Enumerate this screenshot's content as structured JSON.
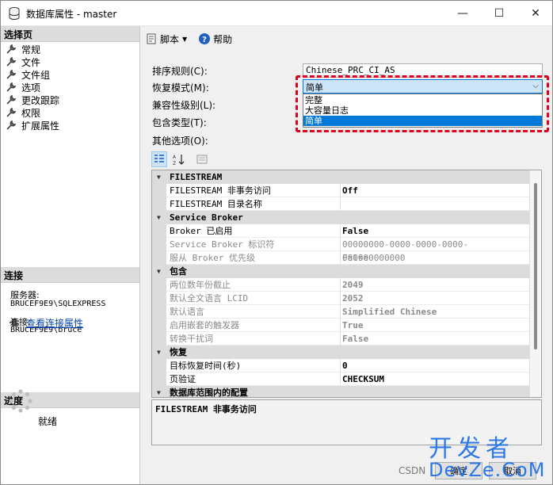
{
  "window": {
    "title": "数据库属性 - master",
    "minimize": "—",
    "maximize": "☐",
    "close": "✕"
  },
  "left_pane": {
    "select_page_header": "选择页",
    "nav_items": [
      "常规",
      "文件",
      "文件组",
      "选项",
      "更改跟踪",
      "权限",
      "扩展属性"
    ],
    "connection_header": "连接",
    "server_label": "服务器:",
    "server_value": "BRUCEF9E9\\SQLEXPRESS",
    "connection_label": "连接:",
    "connection_value": "BRUCEF9E9\\bruce",
    "view_conn_props": "查看连接属性",
    "progress_header": "进度",
    "progress_status": "就绪"
  },
  "toolbar": {
    "script_label": "脚本",
    "help_label": "帮助"
  },
  "form": {
    "collation_label": "排序规则(C):",
    "collation_value": "Chinese_PRC_CI_AS",
    "recovery_label": "恢复模式(M):",
    "recovery_value": "简单",
    "compat_label": "兼容性级别(L):",
    "containment_label": "包含类型(T):",
    "other_label": "其他选项(O):",
    "recovery_options": [
      "完整",
      "大容量日志",
      "简单"
    ],
    "recovery_selected_index": 2
  },
  "property_grid": {
    "categories": [
      {
        "label": "FILESTREAM",
        "rows": [
          {
            "name": "FILESTREAM 非事务访问",
            "value": "Off",
            "grey": false,
            "bold": true
          },
          {
            "name": "FILESTREAM 目录名称",
            "value": "",
            "grey": false,
            "bold": false
          }
        ]
      },
      {
        "label": "Service Broker",
        "rows": [
          {
            "name": "Broker 已启用",
            "value": "False",
            "grey": false,
            "bold": true
          },
          {
            "name": "Service Broker 标识符",
            "value": "00000000-0000-0000-0000-000000000000",
            "grey": true,
            "bold": false
          },
          {
            "name": "服从 Broker 优先级",
            "value": "False",
            "grey": true,
            "bold": false
          }
        ]
      },
      {
        "label": "包含",
        "rows": [
          {
            "name": "两位数年份截止",
            "value": "2049",
            "grey": true,
            "bold": true
          },
          {
            "name": "默认全文语言 LCID",
            "value": "2052",
            "grey": true,
            "bold": true
          },
          {
            "name": "默认语言",
            "value": "Simplified Chinese",
            "grey": true,
            "bold": true
          },
          {
            "name": "启用嵌套的触发器",
            "value": "True",
            "grey": true,
            "bold": true
          },
          {
            "name": "转换干扰词",
            "value": "False",
            "grey": true,
            "bold": true
          }
        ]
      },
      {
        "label": "恢复",
        "rows": [
          {
            "name": "目标恢复时间(秒)",
            "value": "0",
            "grey": false,
            "bold": true
          },
          {
            "name": "页验证",
            "value": "CHECKSUM",
            "grey": false,
            "bold": true
          }
        ]
      },
      {
        "label": "数据库范围内的配置",
        "rows": []
      }
    ],
    "description_title": "FILESTREAM 非事务访问"
  },
  "bottom": {
    "csdn": "CSDN",
    "ok": "确定",
    "cancel": "取消",
    "watermark_top": "开发者",
    "watermark_bottom": "DevZe.CoM"
  },
  "colors": {
    "accent": "#0078d7",
    "highlight_border": "#e0001b",
    "watermark": "#1d6fe6"
  }
}
